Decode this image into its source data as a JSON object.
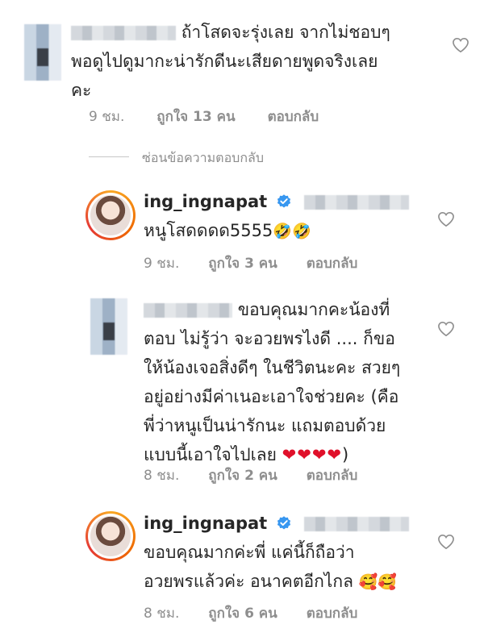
{
  "comments": [
    {
      "username": "",
      "text_lines": [
        "ถ้าโสดจะรุ่งเลย  จากไม่ชอบๆ",
        "พอดูไปดูมากะน่ารักดีนะเสียดายพูดจริงเลย",
        "คะ"
      ],
      "time": "9 ชม.",
      "likes": "ถูกใจ 13 คน",
      "reply": "ตอบกลับ"
    },
    {
      "username": "ing_ingnapat",
      "text": "หนูโสดดดด5555",
      "emoji": "🤣🤣",
      "time": "9 ชม.",
      "likes": "ถูกใจ 3 คน",
      "reply": "ตอบกลับ"
    },
    {
      "username": "",
      "text_lines": [
        "ขอบคุณมากคะน้องที่",
        "ตอบ ไม่รู้ว่า จะอวยพรไงดี .... ก็ขอ",
        "ให้น้องเจอสิ่งดีๆ ในชีวิตนะคะ  สวยๆ",
        "อยู่อย่างมีค่าเนอะเอาใจช่วยคะ (คือ",
        "พี่ว่าหนูเป็นน่ารักนะ แถมตอบด้วย",
        "แบบนี้เอาใจไปเลย"
      ],
      "hearts": "❤❤❤❤",
      "closing": ")",
      "time": "8 ชม.",
      "likes": "ถูกใจ 2 คน",
      "reply": "ตอบกลับ"
    },
    {
      "username": "ing_ingnapat",
      "text_lines": [
        "ขอบคุณมากค่ะพี่ แค่นี้ก็ถือว่า",
        "อวยพรแล้วค่ะ อนาคตอีกไกล"
      ],
      "emoji": "🥰🥰",
      "time": "8 ชม.",
      "likes": "ถูกใจ 6 คน",
      "reply": "ตอบกลับ"
    }
  ],
  "hide_replies": "ซ่อนข้อความตอบกลับ",
  "icons": {
    "like": "heart-outline-icon",
    "verified": "verified-badge-icon"
  },
  "colors": {
    "text": "#262626",
    "meta": "#8e8e8e",
    "verified": "#3897f0",
    "hearts": "#e0102a"
  }
}
